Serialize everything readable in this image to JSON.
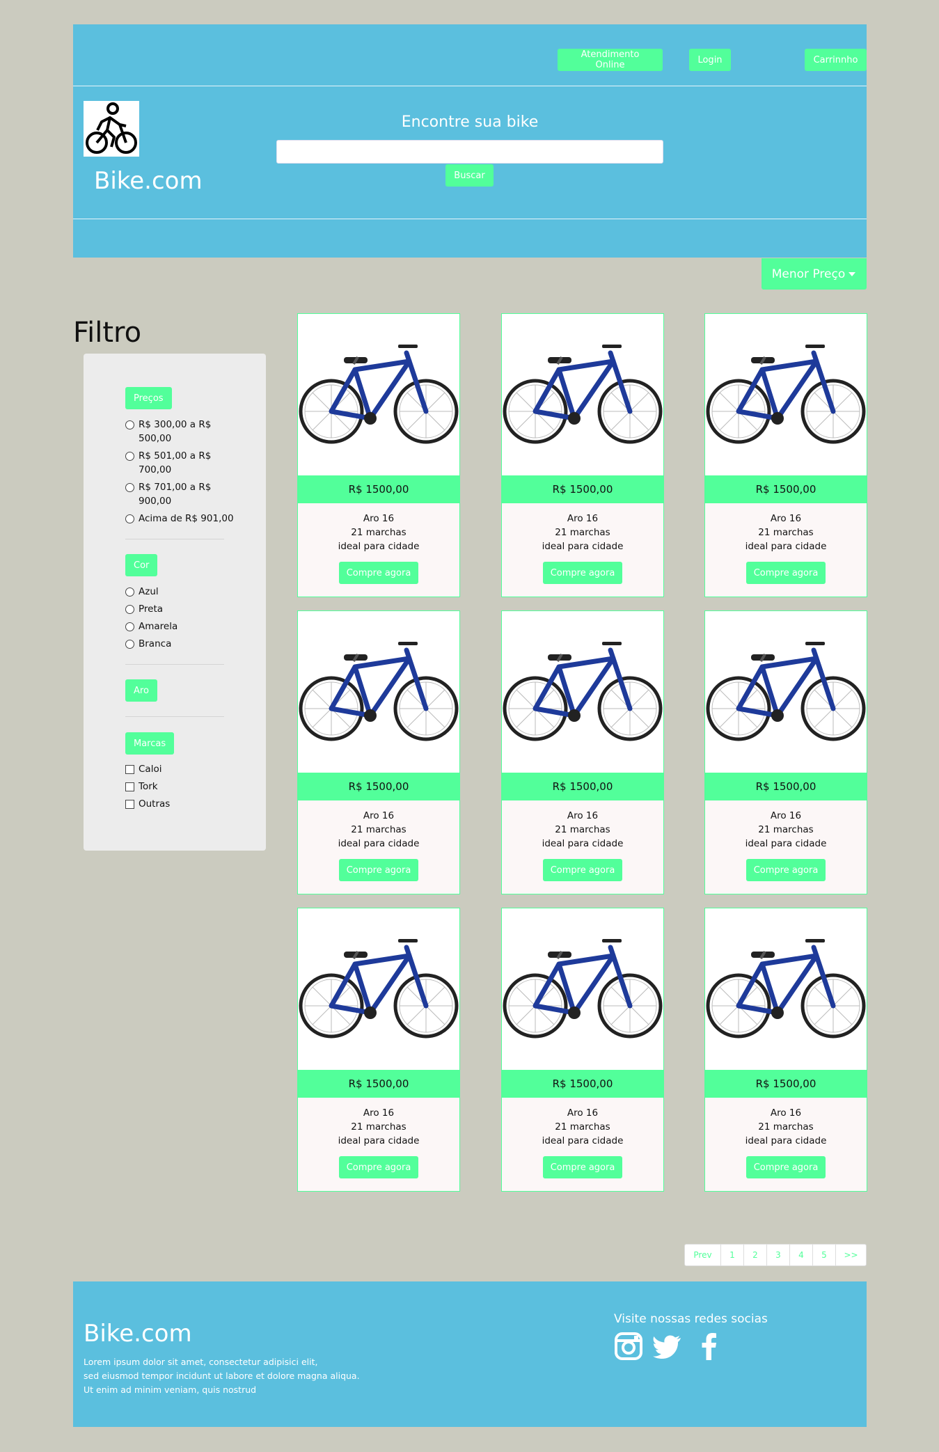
{
  "header": {
    "top_buttons": {
      "atendimento": "Atendimento Online",
      "login": "Login",
      "cart": "Carrinnho"
    },
    "brand": "Bike.com",
    "logo_icon": "cyclist-icon",
    "search": {
      "title": "Encontre sua bike",
      "placeholder": "",
      "button": "Buscar"
    }
  },
  "sort": {
    "label": "Menor Preço",
    "icon": "caret-down-icon"
  },
  "filter": {
    "title": "Filtro",
    "precos": {
      "label": "Preços",
      "options": [
        "R$ 300,00 a R$ 500,00",
        "R$ 501,00 a R$ 700,00",
        "R$ 701,00 a R$ 900,00",
        "Acima de R$ 901,00"
      ]
    },
    "cor": {
      "label": "Cor",
      "options": [
        "Azul",
        "Preta",
        "Amarela",
        "Branca"
      ]
    },
    "aro": {
      "label": "Aro"
    },
    "marcas": {
      "label": "Marcas",
      "options": [
        "Caloi",
        "Tork",
        "Outras"
      ]
    }
  },
  "products": [
    {
      "price": "R$ 1500,00",
      "line1": "Aro 16",
      "line2": "21 marchas",
      "line3": "ideal para cidade",
      "button": "Compre agora"
    },
    {
      "price": "R$ 1500,00",
      "line1": "Aro 16",
      "line2": "21 marchas",
      "line3": "ideal para cidade",
      "button": "Compre agora"
    },
    {
      "price": "R$ 1500,00",
      "line1": "Aro 16",
      "line2": "21 marchas",
      "line3": "ideal para cidade",
      "button": "Compre agora"
    },
    {
      "price": "R$ 1500,00",
      "line1": "Aro 16",
      "line2": "21 marchas",
      "line3": "ideal para cidade",
      "button": "Compre agora"
    },
    {
      "price": "R$ 1500,00",
      "line1": "Aro 16",
      "line2": "21 marchas",
      "line3": "ideal para cidade",
      "button": "Compre agora"
    },
    {
      "price": "R$ 1500,00",
      "line1": "Aro 16",
      "line2": "21 marchas",
      "line3": "ideal para cidade",
      "button": "Compre agora"
    },
    {
      "price": "R$ 1500,00",
      "line1": "Aro 16",
      "line2": "21 marchas",
      "line3": "ideal para cidade",
      "button": "Compre agora"
    },
    {
      "price": "R$ 1500,00",
      "line1": "Aro 16",
      "line2": "21 marchas",
      "line3": "ideal para cidade",
      "button": "Compre agora"
    },
    {
      "price": "R$ 1500,00",
      "line1": "Aro 16",
      "line2": "21 marchas",
      "line3": "ideal para cidade",
      "button": "Compre agora"
    }
  ],
  "pagination": [
    "Prev",
    "1",
    "2",
    "3",
    "4",
    "5",
    ">>"
  ],
  "footer": {
    "brand": "Bike.com",
    "lorem": [
      "Lorem ipsum dolor sit amet, consectetur adipisici elit,",
      "sed eiusmod tempor incidunt ut labore et dolore magna aliqua.",
      "Ut enim ad minim veniam, quis nostrud"
    ],
    "social_title": "Visite nossas redes socias",
    "social_icons": [
      "instagram-icon",
      "twitter-icon",
      "facebook-icon"
    ]
  },
  "colors": {
    "background": "#cbcbbf",
    "header": "#5bbfde",
    "accent": "#52ff9a",
    "panel": "#ececec",
    "bike": "#1e3a9a"
  }
}
